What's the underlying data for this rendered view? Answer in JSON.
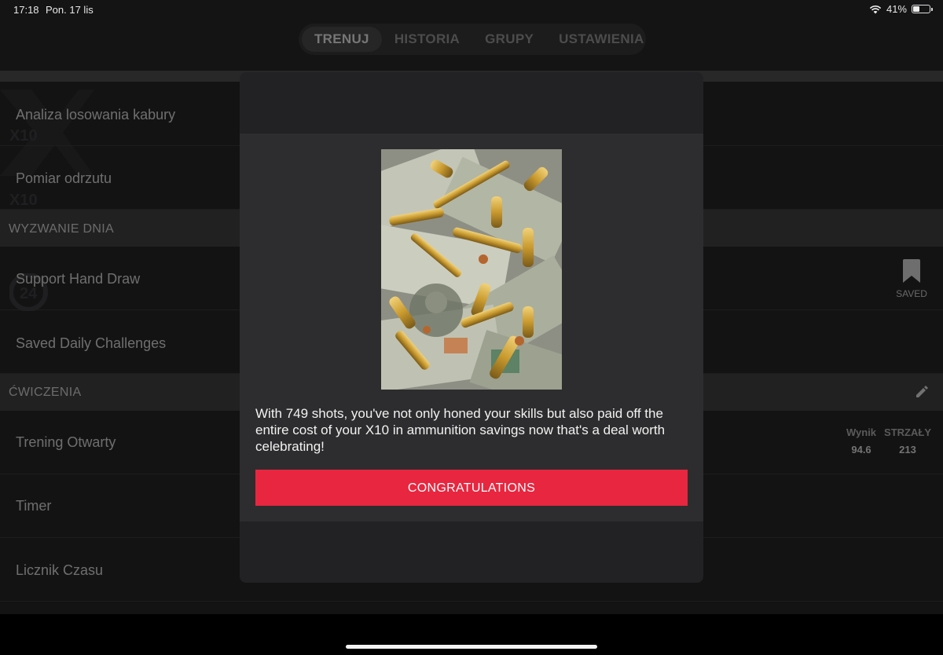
{
  "status": {
    "time": "17:18",
    "date": "Pon. 17 lis",
    "battery": "41%",
    "battery_level": 0.41
  },
  "tabs": [
    {
      "label": "TRENUJ",
      "active": true
    },
    {
      "label": "HISTORIA",
      "active": false
    },
    {
      "label": "GRUPY",
      "active": false
    },
    {
      "label": "USTAWIENIA",
      "active": false
    }
  ],
  "list": {
    "rows_top": [
      {
        "label": "Analiza losowania kabury"
      },
      {
        "label": "Pomiar odrzutu"
      }
    ],
    "daily_section": "WYZWANIE DNIA",
    "daily_rows": [
      {
        "label": "Support Hand Draw",
        "saved_label": "SAVED"
      },
      {
        "label": "Saved Daily Challenges"
      }
    ],
    "exercises_section": "ĆWICZENIA",
    "exercise_rows": [
      {
        "label": "Trening Otwarty",
        "score_header": "Wynik",
        "shots_header": "STRZAŁY",
        "score": "94.6",
        "shots": "213"
      },
      {
        "label": "Timer"
      },
      {
        "label": "Licznik Czasu"
      }
    ],
    "watermark": "X10"
  },
  "modal": {
    "text": "With 749 shots, you've not only honed your skills but also paid off the entire cost of your X10 in ammunition savings now that's a deal worth celebrating!",
    "button": "CONGRATULATIONS"
  },
  "colors": {
    "accent": "#e8263f",
    "background": "#242426",
    "modal": "#2d2d2f"
  }
}
